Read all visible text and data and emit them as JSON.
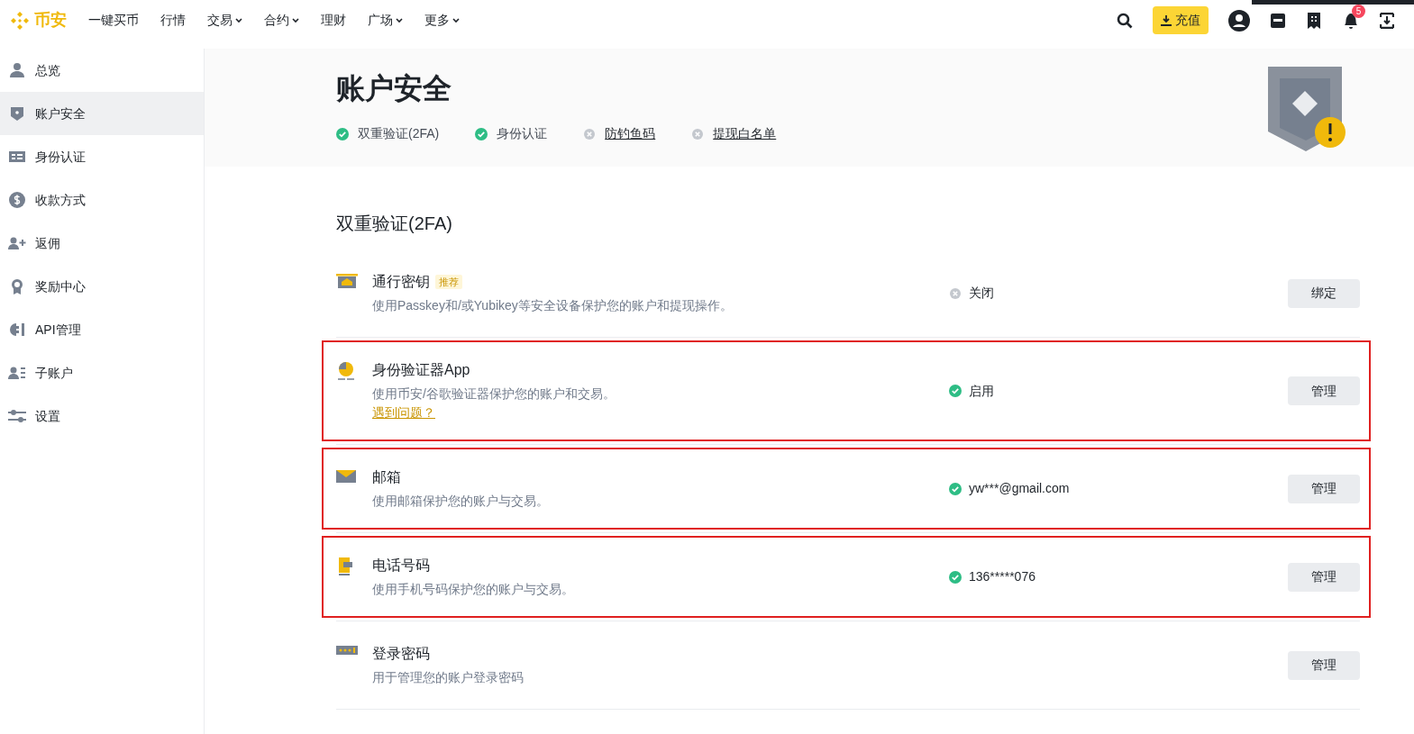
{
  "nav": {
    "logo": "币安",
    "items": [
      {
        "label": "一键买币",
        "dropdown": false
      },
      {
        "label": "行情",
        "dropdown": false
      },
      {
        "label": "交易",
        "dropdown": true
      },
      {
        "label": "合约",
        "dropdown": true
      },
      {
        "label": "理财",
        "dropdown": false
      },
      {
        "label": "广场",
        "dropdown": true
      },
      {
        "label": "更多",
        "dropdown": true
      }
    ],
    "deposit": "充值",
    "notifications": "5"
  },
  "sidebar": {
    "items": [
      {
        "label": "总览",
        "selected": false
      },
      {
        "label": "账户安全",
        "selected": true
      },
      {
        "label": "身份认证",
        "selected": false
      },
      {
        "label": "收款方式",
        "selected": false
      },
      {
        "label": "返佣",
        "selected": false
      },
      {
        "label": "奖励中心",
        "selected": false
      },
      {
        "label": "API管理",
        "selected": false
      },
      {
        "label": "子账户",
        "selected": false
      },
      {
        "label": "设置",
        "selected": false
      }
    ]
  },
  "header": {
    "title": "账户安全",
    "checks": [
      {
        "label": "双重验证(2FA)",
        "done": true
      },
      {
        "label": "身份认证",
        "done": true
      },
      {
        "label": "防钓鱼码",
        "done": false
      },
      {
        "label": "提现白名单",
        "done": false
      }
    ]
  },
  "section": {
    "title": "双重验证(2FA)",
    "rows": [
      {
        "title": "通行密钥",
        "tag": "推荐",
        "description": "使用Passkey和/或Yubikey等安全设备保护您的账户和提现操作。",
        "status": {
          "text": "关闭",
          "on": false
        },
        "button": "绑定",
        "highlighted": false
      },
      {
        "title": "身份验证器App",
        "description": "使用币安/谷歌验证器保护您的账户和交易。",
        "link": "遇到问题？",
        "status": {
          "text": "启用",
          "on": true
        },
        "button": "管理",
        "highlighted": true
      },
      {
        "title": "邮箱",
        "description": "使用邮箱保护您的账户与交易。",
        "status": {
          "text": "yw***@gmail.com",
          "on": true
        },
        "button": "管理",
        "highlighted": true
      },
      {
        "title": "电话号码",
        "description": "使用手机号码保护您的账户与交易。",
        "status": {
          "text": "136*****076",
          "on": true
        },
        "button": "管理",
        "highlighted": true
      },
      {
        "title": "登录密码",
        "description": "用于管理您的账户登录密码",
        "button": "管理",
        "highlighted": false
      }
    ]
  }
}
